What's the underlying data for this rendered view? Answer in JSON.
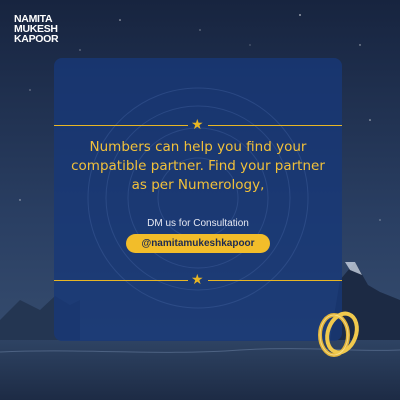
{
  "brand": {
    "line1": "NAMITA",
    "line2": "MUKESH",
    "line3": "KAPOOR"
  },
  "card": {
    "headline": "Numbers can help you find your compatible partner. Find your partner as per Numerology,",
    "cta_label": "DM us for Consultation",
    "handle": "@namitamukeshkapoor",
    "divider_icon": "star-icon"
  },
  "colors": {
    "accent": "#f2bd2a",
    "card": "#183878",
    "background": "#1b2c4e"
  }
}
